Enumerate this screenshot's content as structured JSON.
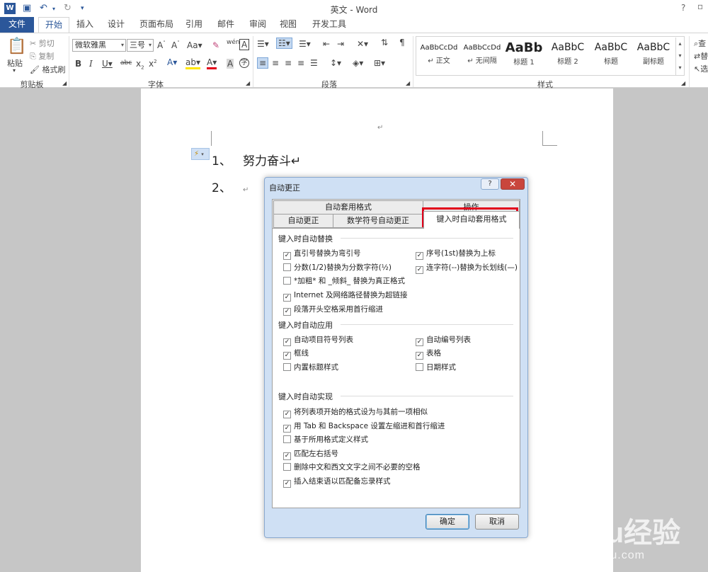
{
  "app": {
    "title": "英文 - Word",
    "help": "?"
  },
  "tabs": [
    "文件",
    "开始",
    "插入",
    "设计",
    "页面布局",
    "引用",
    "邮件",
    "审阅",
    "视图",
    "开发工具"
  ],
  "ribbon": {
    "clipboard": {
      "paste": "粘贴",
      "cut": "剪切",
      "copy": "复制",
      "format_painter": "格式刷",
      "label": "剪贴板"
    },
    "font": {
      "name": "微软雅黑",
      "size": "三号",
      "label": "字体"
    },
    "paragraph": {
      "label": "段落"
    },
    "styles": {
      "label": "样式",
      "items": [
        {
          "sample": "AaBbCcDd",
          "name": "↵ 正文"
        },
        {
          "sample": "AaBbCcDd",
          "name": "↵ 无间隔"
        },
        {
          "sample": "AaBb",
          "name": "标题 1"
        },
        {
          "sample": "AaBbC",
          "name": "标题 2"
        },
        {
          "sample": "AaBbC",
          "name": "标题"
        },
        {
          "sample": "AaBbC",
          "name": "副标题"
        }
      ]
    },
    "edit_partial": [
      "查",
      "替",
      "选"
    ]
  },
  "document": {
    "item1_num": "1、",
    "item1_text": "努力奋斗↵",
    "item2_num": "2、",
    "item2_text": "↵",
    "para_mark": "↵"
  },
  "dialog": {
    "title": "自动更正",
    "help": "?",
    "close": "✕",
    "tabs_top": [
      "自动套用格式",
      "操作"
    ],
    "tabs_bottom": [
      "自动更正",
      "数学符号自动更正",
      "键入时自动套用格式"
    ],
    "sections": {
      "replace": "键入时自动替换",
      "apply": "键入时自动应用",
      "auto": "键入时自动实现"
    },
    "replace_left": [
      {
        "label": "直引号替换为弯引号",
        "checked": "✓"
      },
      {
        "label": "分数(1/2)替换为分数字符(½)",
        "checked": ""
      },
      {
        "label": "*加粗* 和 _倾斜_ 替换为真正格式",
        "checked": ""
      },
      {
        "label": "Internet 及网络路径替换为超链接",
        "checked": "✓"
      },
      {
        "label": "段落开头空格采用首行缩进",
        "checked": "✓"
      }
    ],
    "replace_right": [
      {
        "label": "序号(1st)替换为上标",
        "checked": "✓"
      },
      {
        "label": "连字符(--)替换为长划线(—)",
        "checked": "✓"
      }
    ],
    "apply_left": [
      {
        "label": "自动项目符号列表",
        "checked": "✓"
      },
      {
        "label": "框线",
        "checked": "✓"
      },
      {
        "label": "内置标题样式",
        "checked": ""
      }
    ],
    "apply_right": [
      {
        "label": "自动编号列表",
        "checked": "✓"
      },
      {
        "label": "表格",
        "checked": "✓"
      },
      {
        "label": "日期样式",
        "checked": ""
      }
    ],
    "auto_items": [
      {
        "label": "将列表项开始的格式设为与其前一项相似",
        "checked": "✓"
      },
      {
        "label": "用 Tab 和 Backspace 设置左缩进和首行缩进",
        "checked": "✓"
      },
      {
        "label": "基于所用格式定义样式",
        "checked": ""
      },
      {
        "label": "匹配左右括号",
        "checked": "✓"
      },
      {
        "label": "删除中文和西文文字之间不必要的空格",
        "checked": ""
      },
      {
        "label": "插入结束语以匹配备忘录样式",
        "checked": "✓"
      }
    ],
    "ok": "确定",
    "cancel": "取消"
  },
  "watermark": {
    "brand": "Baidu经验",
    "url": "jingyan.baidu.com"
  }
}
